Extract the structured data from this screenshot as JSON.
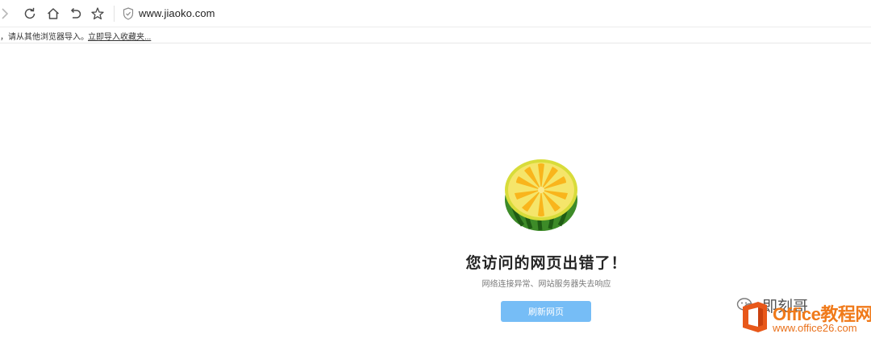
{
  "browser": {
    "url": "www.jiaoko.com"
  },
  "bookmark_bar": {
    "message": "，请从其他浏览器导入。",
    "import_link": "立即导入收藏夹..."
  },
  "error_page": {
    "title": "您访问的网页出错了！",
    "subtitle": "网络连接异常、网站服务器失去响应",
    "refresh_button": "刷新网页",
    "accent_color": "#76bdf6"
  },
  "watermarks": {
    "wechat_name": "即刻哥",
    "brand": "Office教程网",
    "site": "www.office26.com",
    "brand_color": "#f07a1a"
  },
  "icons": [
    "forward-icon",
    "reload-icon",
    "home-icon",
    "undo-icon",
    "star-icon",
    "shield-icon",
    "fruit-icon",
    "wechat-icon",
    "office-logo-icon"
  ]
}
